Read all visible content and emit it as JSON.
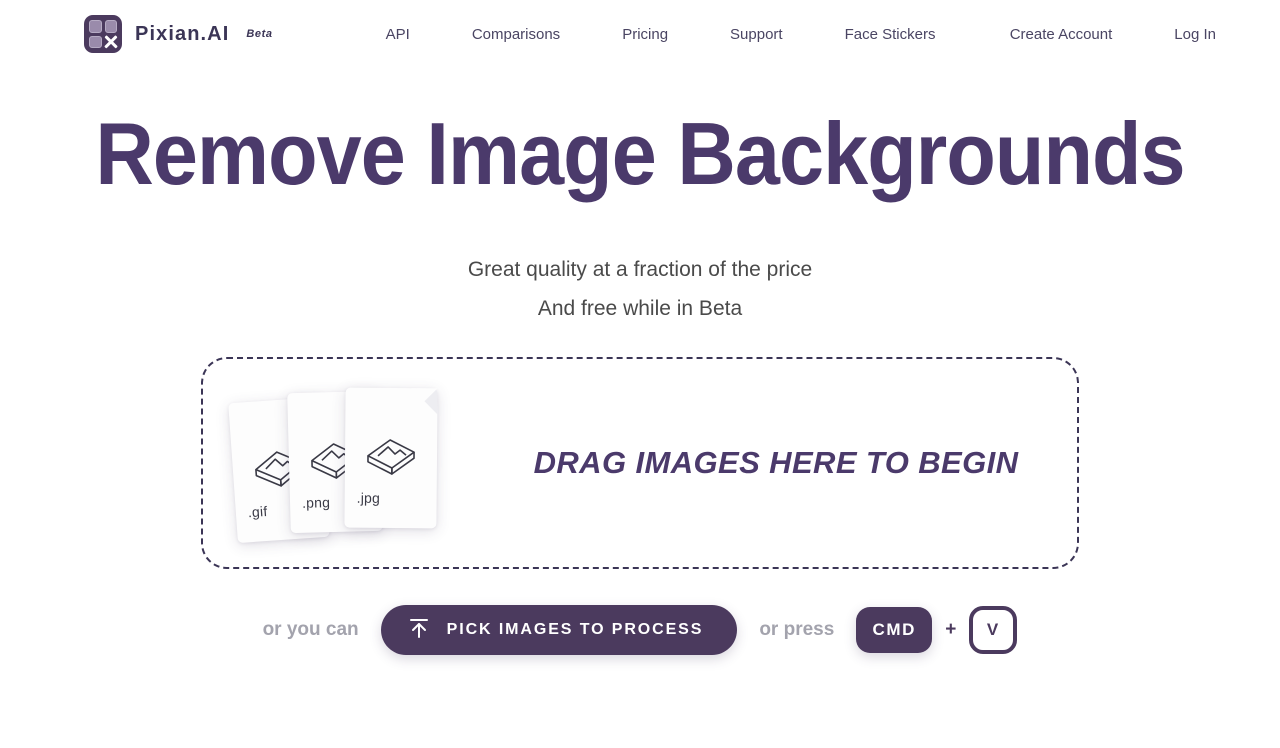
{
  "header": {
    "logo_icon": "pixian-grid-x-logo",
    "brand_name": "Pixian.AI",
    "brand_badge": "Beta",
    "nav_left": [
      {
        "label": "API",
        "name": "nav-link-api"
      },
      {
        "label": "Comparisons",
        "name": "nav-link-comparisons"
      },
      {
        "label": "Pricing",
        "name": "nav-link-pricing"
      },
      {
        "label": "Support",
        "name": "nav-link-support"
      },
      {
        "label": "Face Stickers",
        "name": "nav-link-face-stickers"
      }
    ],
    "nav_right": [
      {
        "label": "Create Account",
        "name": "nav-link-create-account"
      },
      {
        "label": "Log In",
        "name": "nav-link-log-in"
      }
    ]
  },
  "hero": {
    "headline": "Remove Image Backgrounds",
    "subtitle_1": "Great quality at a fraction of the price",
    "subtitle_2": "And free while in Beta"
  },
  "dropzone": {
    "prompt": "DRAG IMAGES HERE TO BEGIN",
    "cards": [
      {
        "label": ".gif",
        "icon": "image-file-icon"
      },
      {
        "label": ".png",
        "icon": "image-file-icon"
      },
      {
        "label": ".jpg",
        "icon": "image-file-icon"
      }
    ]
  },
  "actions": {
    "or_you_can": "or you can",
    "pick_button_label": "PICK IMAGES TO PROCESS",
    "pick_button_icon": "upload-icon",
    "or_press": "or press",
    "key_cmd": "CMD",
    "key_plus": "+",
    "key_v": "V"
  },
  "colors": {
    "brand_purple": "#4b3a5e",
    "headline_purple": "#4b3a6b",
    "nav_text": "#4a4563",
    "muted_gray": "#a3a3ad",
    "subtitle_gray": "#4a4a4a",
    "page_background": "#ffffff"
  }
}
